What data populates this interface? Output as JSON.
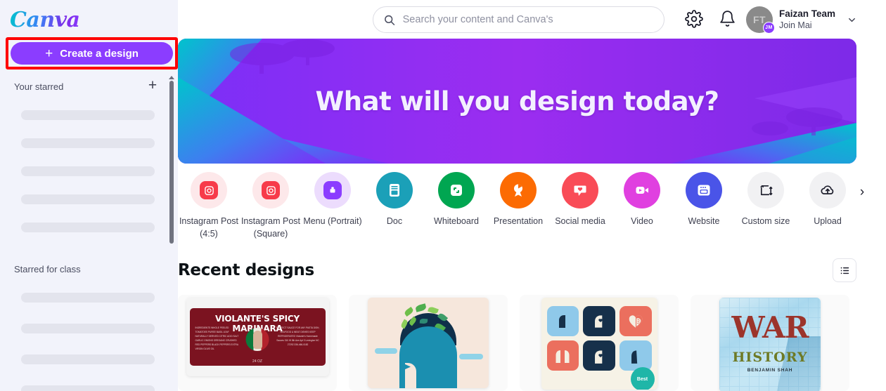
{
  "sidebar": {
    "logo_text": "Canva",
    "create_button": {
      "label": "Create a design",
      "icon": "plus-icon"
    },
    "sections": [
      {
        "title": "Your starred",
        "add_icon": "plus-icon",
        "skeleton_count": 5
      },
      {
        "title": "Starred for class",
        "skeleton_count": 4
      }
    ]
  },
  "header": {
    "search": {
      "placeholder": "Search your content and Canva's",
      "value": "",
      "icon": "search-icon"
    },
    "settings_icon": "gear-icon",
    "notifications_icon": "bell-icon",
    "account": {
      "initials": "FT",
      "badge": "JM",
      "name": "Faizan Team",
      "subtitle": "Join Mai",
      "chevron": "chevron-down-icon"
    }
  },
  "banner": {
    "title": "What will you design today?",
    "bg_purple": "#8b3dff",
    "bg_teal": "#00c4cc"
  },
  "categories": {
    "next_arrow": "chevron-right-icon",
    "items": [
      {
        "label": "Instagram Post (4:5)",
        "icon": "instagram-icon",
        "circle": "#fde8ea",
        "chip": "#f73b4a"
      },
      {
        "label": "Instagram Post (Square)",
        "icon": "instagram-icon",
        "circle": "#fde8ea",
        "chip": "#f73b4a"
      },
      {
        "label": "Menu (Portrait)",
        "icon": "menu-doc-icon",
        "circle": "#ecdcfd",
        "chip": "#8b3dff"
      },
      {
        "label": "Doc",
        "icon": "doc-icon",
        "circle": "#1ba0b8",
        "chip": "#1ba0b8"
      },
      {
        "label": "Whiteboard",
        "icon": "whiteboard-icon",
        "circle": "#00a651",
        "chip": "#00a651"
      },
      {
        "label": "Presentation",
        "icon": "presentation-icon",
        "circle": "#fc6b03",
        "chip": "#fc6b03"
      },
      {
        "label": "Social media",
        "icon": "social-media-icon",
        "circle": "#f94c57",
        "chip": "#f94c57"
      },
      {
        "label": "Video",
        "icon": "video-icon",
        "circle": "#e040e0",
        "chip": "#e040e0"
      },
      {
        "label": "Website",
        "icon": "website-icon",
        "circle": "#4a54e8",
        "chip": "#4a54e8"
      },
      {
        "label": "Custom size",
        "icon": "resize-icon",
        "circle": "#f1f1f3",
        "chip": "#f1f1f3"
      },
      {
        "label": "Upload",
        "icon": "upload-cloud-icon",
        "circle": "#f1f1f3",
        "chip": "#f1f1f3"
      }
    ]
  },
  "recent": {
    "title": "Recent designs",
    "view_toggle_icon": "list-view-icon",
    "designs": [
      {
        "type": "product-label",
        "title": "VIOLANTE'S SPICY MARINARA",
        "left_text": "INGREDIENTS WHOLE PEELED TOMATOES PUREE BASIL LEAF NATURALLY DERIVED CITRIC ACID SALT GARLIC ONIONS OREGANO CRUSHED RED PEPPERS BLACK PEPPERS EXTRA VIRGIN OLIVE OIL",
        "right_text": "PERFECT SAUCE FOR ANY PASTA DISH, SEAFOOD & MEAT DISHES KEEP REFRIGERATED Violante's Homemade Sauces 310 W 5th Ave Apt 3 Lexington NC 27292 336-466-0182",
        "size_text": "24 OZ"
      },
      {
        "type": "illustration",
        "title": "Head with growing plants"
      },
      {
        "type": "icon-grid",
        "title": "Mental health icon set",
        "badge": "Best"
      },
      {
        "type": "book-cover",
        "title": "WAR",
        "subtitle": "HISTORY",
        "author": "BENJAMIN SHAH"
      }
    ]
  }
}
